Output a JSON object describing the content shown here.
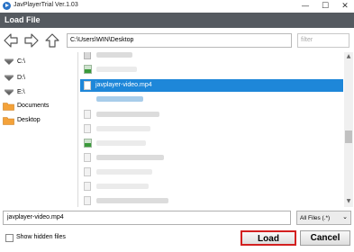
{
  "window": {
    "title": "JavPlayerTrial Ver.1.03"
  },
  "window_controls": {
    "minimize": "—",
    "maximize": "☐",
    "close": "✕"
  },
  "dialog": {
    "title": "Load  File"
  },
  "nav": {
    "back_icon": "left-arrow-icon",
    "forward_icon": "right-arrow-icon",
    "up_icon": "up-arrow-icon"
  },
  "path": {
    "value": "C:\\Users\\WIN\\Desktop"
  },
  "filter": {
    "placeholder": "filter"
  },
  "sidebar": {
    "items": [
      {
        "label": "C:\\",
        "icon": "drive-icon"
      },
      {
        "label": "D:\\",
        "icon": "drive-icon"
      },
      {
        "label": "E:\\",
        "icon": "drive-icon"
      },
      {
        "label": "Documents",
        "icon": "folder-icon"
      },
      {
        "label": "Desktop",
        "icon": "folder-icon"
      }
    ]
  },
  "files": {
    "selected_name": "javplayer-video.mp4"
  },
  "scrollbar": {
    "up": "▲",
    "down": "▼"
  },
  "footer": {
    "filename_value": "javplayer-video.mp4",
    "type_filter": "All Files (.*)",
    "type_chevron": "⌄",
    "show_hidden_label": "Show hidden files",
    "load_label": "Load",
    "cancel_label": "Cancel"
  },
  "colors": {
    "selection": "#1e87d9",
    "header": "#555a60",
    "load_highlight": "#d32020"
  }
}
